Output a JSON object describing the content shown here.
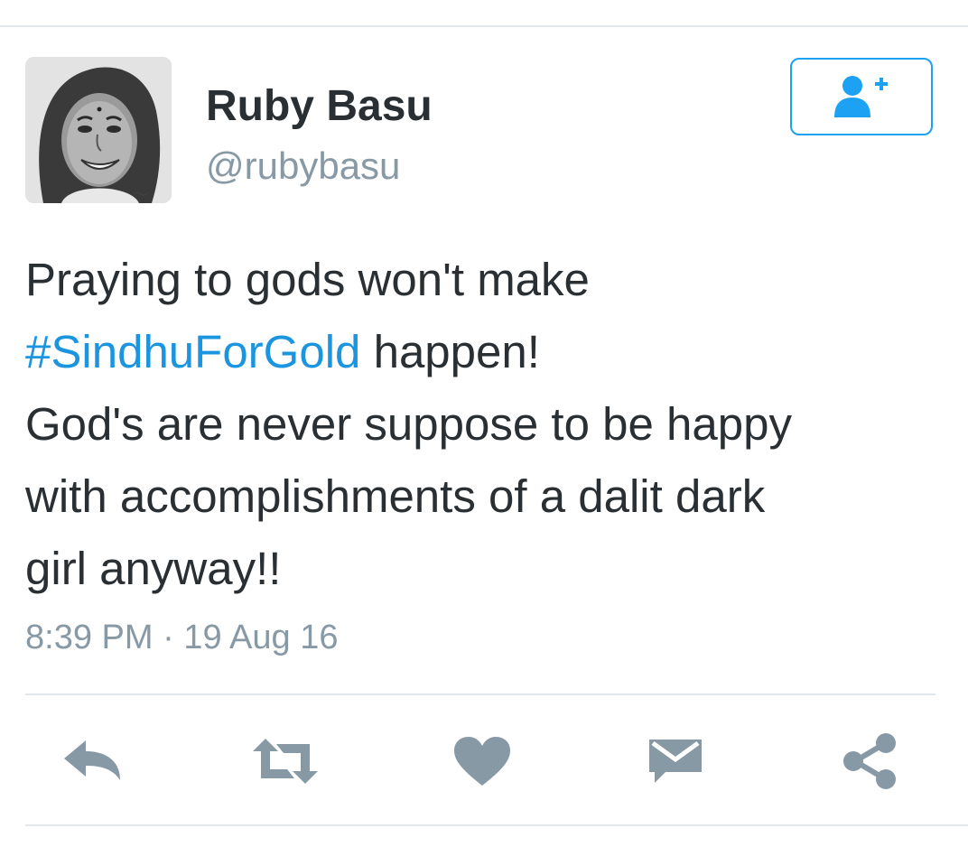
{
  "user": {
    "name": "Ruby Basu",
    "handle": "@rubybasu"
  },
  "follow_button": {
    "icon": "follow-user-plus-icon"
  },
  "tweet": {
    "line1": "Praying to gods won't make",
    "hashtag": "#SindhuForGold",
    "line2_rest": " happen!",
    "line3": "God's are never suppose to be happy",
    "line4": "with accomplishments of a dalit dark",
    "line5": "girl anyway!!"
  },
  "meta": {
    "time": "8:39 PM",
    "separator": " · ",
    "date": "19 Aug 16"
  },
  "actions": [
    {
      "icon": "reply-icon"
    },
    {
      "icon": "retweet-icon"
    },
    {
      "icon": "like-heart-icon"
    },
    {
      "icon": "direct-message-icon"
    },
    {
      "icon": "share-icon"
    }
  ],
  "colors": {
    "accent": "#1da1f2",
    "hashtag": "#1b95e0",
    "text": "#292f33",
    "muted": "#8899a6",
    "icon": "#8899a6",
    "divider": "#e1e8ed"
  }
}
